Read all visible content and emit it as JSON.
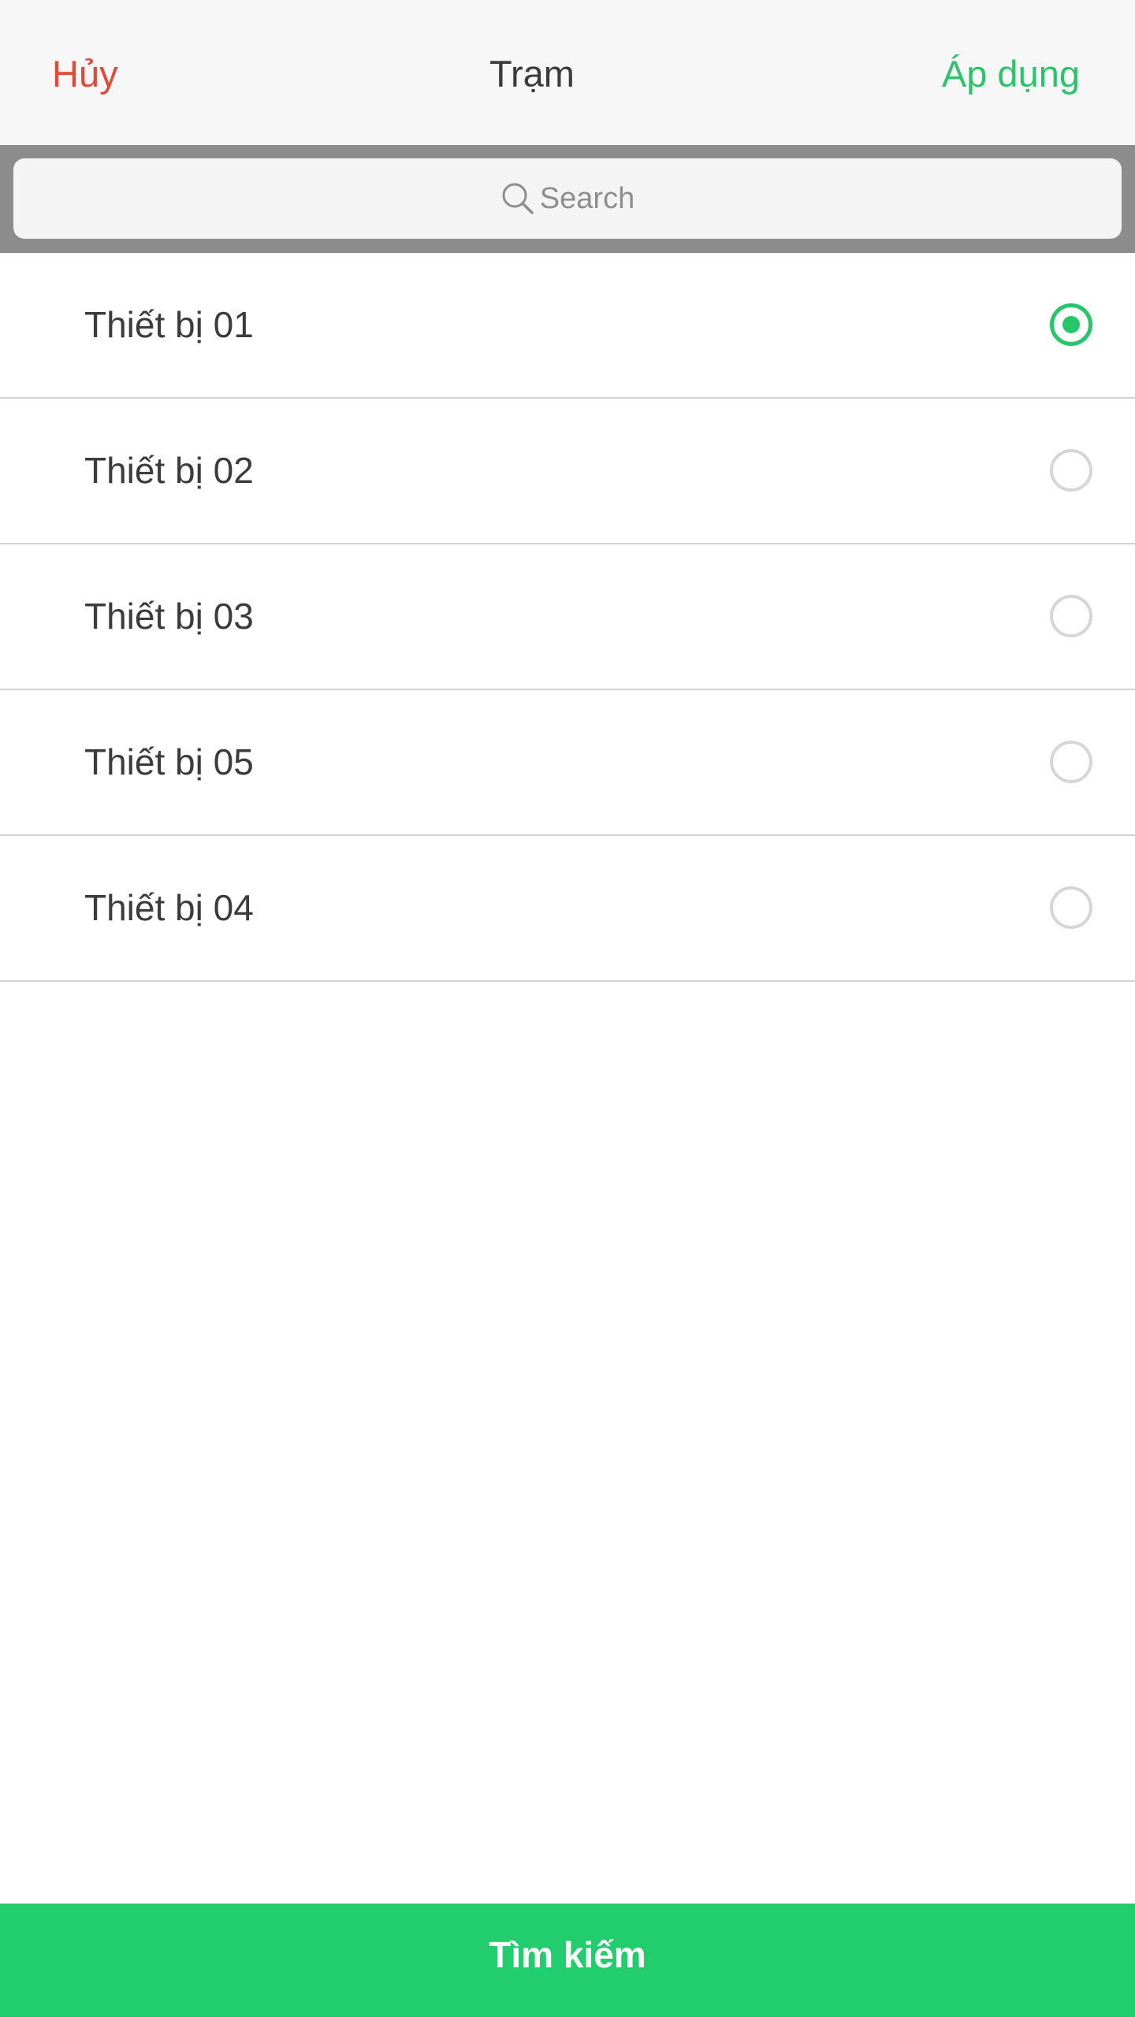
{
  "header": {
    "cancel_label": "Hủy",
    "title": "Trạm",
    "apply_label": "Áp dụng"
  },
  "search": {
    "placeholder": "Search",
    "icon": "search-icon"
  },
  "devices": [
    {
      "label": "Thiết bị 01",
      "selected": true
    },
    {
      "label": "Thiết bị 02",
      "selected": false
    },
    {
      "label": "Thiết bị 03",
      "selected": false
    },
    {
      "label": "Thiết bị 05",
      "selected": false
    },
    {
      "label": "Thiết bị 04",
      "selected": false
    }
  ],
  "footer": {
    "search_button_label": "Tìm kiếm"
  },
  "colors": {
    "cancel": "#e04a36",
    "accent": "#21cd6c",
    "header_bg": "#f7f7f7",
    "search_bar_bg": "#8c8c8c"
  }
}
